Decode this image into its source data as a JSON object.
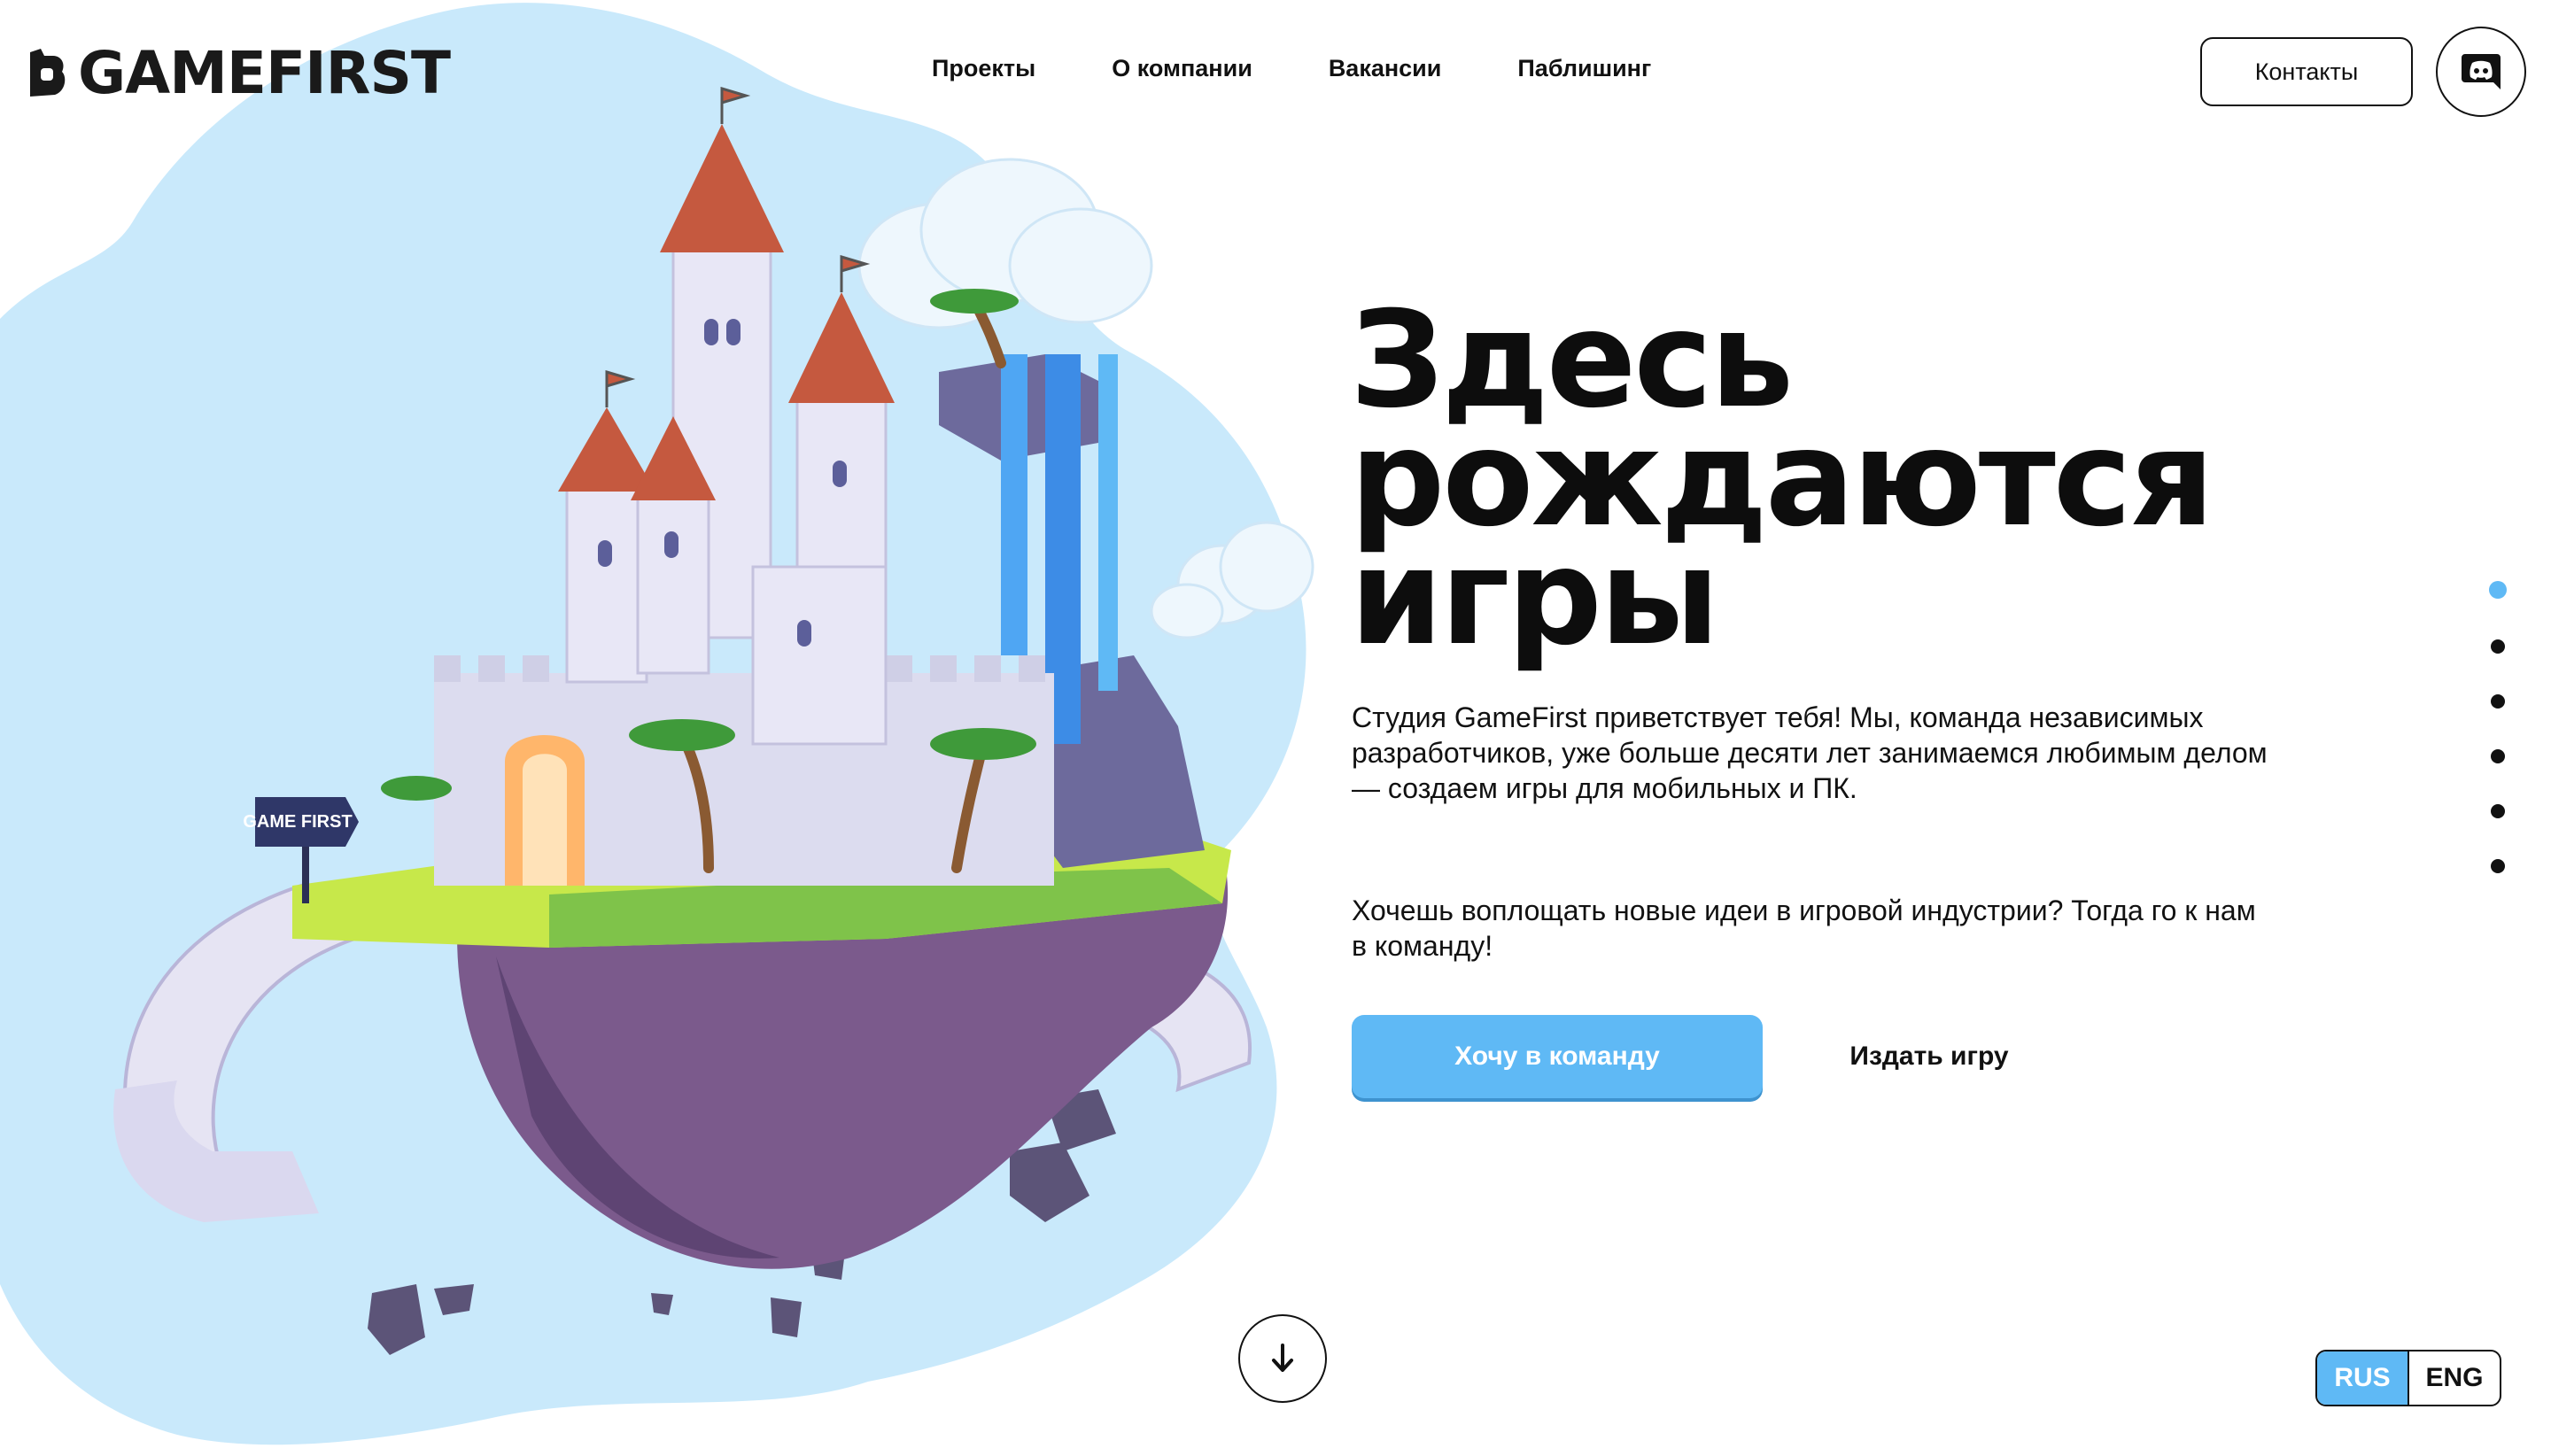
{
  "brand": {
    "name": "GAMEFIRST",
    "sign_text": "GAME FIRST"
  },
  "nav": {
    "items": [
      {
        "label": "Проекты"
      },
      {
        "label": "О компании"
      },
      {
        "label": "Вакансии"
      },
      {
        "label": "Паблишинг"
      }
    ]
  },
  "header": {
    "contacts_label": "Контакты",
    "discord_icon": "discord-icon"
  },
  "hero": {
    "title_lines": [
      "Здесь",
      "рождаются",
      "игры"
    ],
    "paragraph1": "Студия GameFirst приветствует тебя! Мы, команда независимых разработчиков, уже больше десяти лет занимаемся любимым делом — создаем игры для мобильных и ПК.",
    "paragraph2": "Хочешь воплощать новые идеи в игровой индустрии? Тогда го к нам в команду!",
    "primary_cta": "Хочу в команду",
    "secondary_cta": "Издать игру"
  },
  "pagination": {
    "count": 6,
    "active_index": 0
  },
  "scroll_icon": "arrow-down-icon",
  "language": {
    "options": [
      "RUS",
      "ENG"
    ],
    "selected": "RUS"
  },
  "colors": {
    "accent": "#5fb9f5",
    "blob": "#c9e9fb",
    "text": "#111111"
  }
}
